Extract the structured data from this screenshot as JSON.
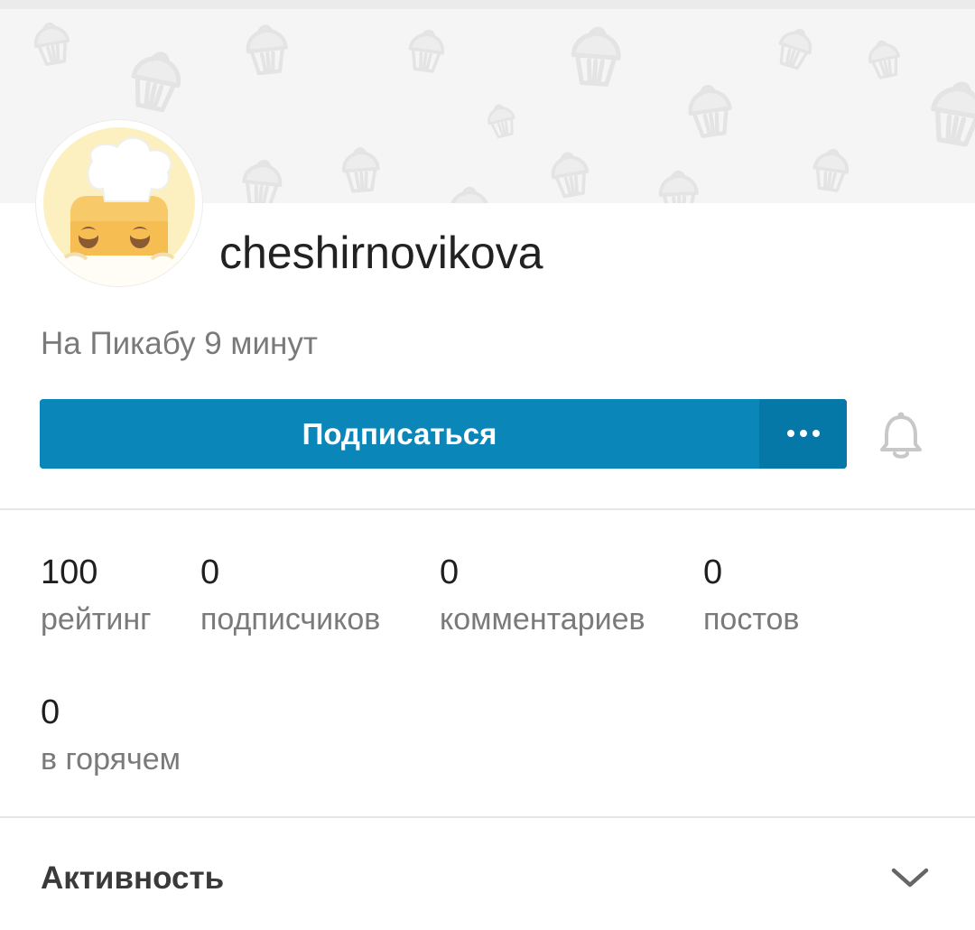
{
  "profile": {
    "username": "cheshirnovikova",
    "since": "На Пикабу 9 минут",
    "avatar_icon": "chef-avatar-icon",
    "cover_pattern": "cupcake-pattern-icon"
  },
  "actions": {
    "subscribe_label": "Подписаться",
    "more_icon": "more-dots-icon",
    "bell_icon": "bell-icon"
  },
  "stats": {
    "rating": {
      "value": "100",
      "label": "рейтинг"
    },
    "subscribers": {
      "value": "0",
      "label": "подписчиков"
    },
    "comments": {
      "value": "0",
      "label": "комментариев"
    },
    "posts": {
      "value": "0",
      "label": "постов"
    },
    "hot": {
      "value": "0",
      "label": "в горячем"
    }
  },
  "activity": {
    "title": "Активность",
    "chevron_icon": "chevron-down-icon"
  },
  "colors": {
    "accent": "#0a86b9",
    "accent_dark": "#0678a8",
    "cover_bg": "#f5f5f5",
    "muted_text": "#7a7a7a"
  }
}
